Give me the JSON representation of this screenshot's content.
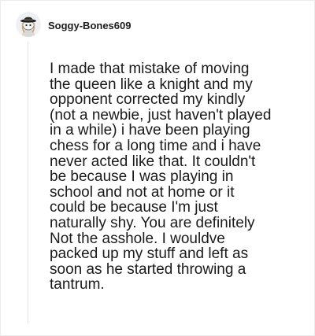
{
  "post": {
    "username": "Soggy-Bones609",
    "avatar_icon": "snoo-avatar-icon",
    "comment_lines": [
      "I made that mistake of moving",
      "the queen like a knight and my",
      "opponent corrected my kindly",
      "(not a newbie, just haven't played",
      "in a while) i have been playing",
      "chess for a long time and i have",
      "never acted like that. It couldn't",
      "be because I was playing in",
      "school and not at home or it",
      "could be because I'm just",
      "naturally shy. You are definitely",
      "Not the asshole. I wouldve",
      "packed up my stuff and left as",
      "soon as he started throwing a",
      "tantrum."
    ]
  }
}
